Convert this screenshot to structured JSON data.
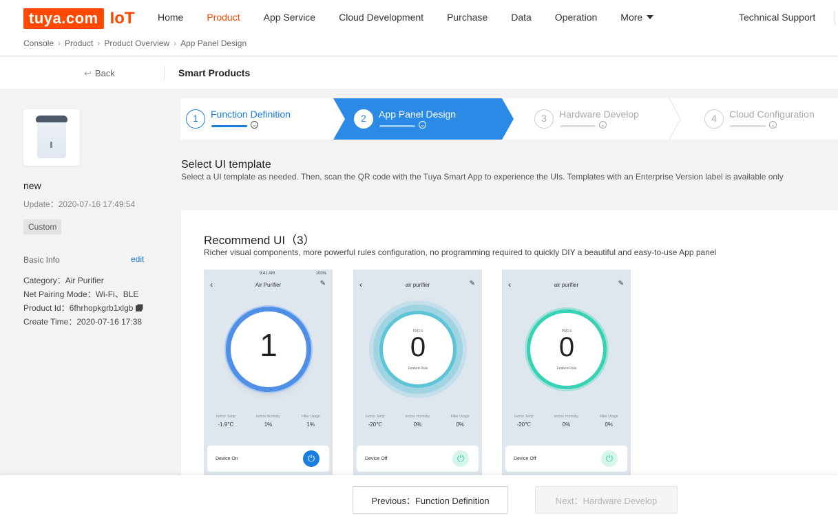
{
  "brand": {
    "logo_text": "tuya.com",
    "logo_suffix": "IoT",
    "accent": "#ff4800",
    "primary": "#1a7de0"
  },
  "nav": {
    "items": [
      "Home",
      "Product",
      "App Service",
      "Cloud Development",
      "Purchase",
      "Data",
      "Operation",
      "More"
    ],
    "active": "Product",
    "tech_support": "Technical Support"
  },
  "breadcrumb": [
    "Console",
    "Product",
    "Product Overview",
    "App Panel Design"
  ],
  "subheader": {
    "back": "Back",
    "title": "Smart Products"
  },
  "product": {
    "name": "new",
    "update": "Update：2020-07-16 17:49:54",
    "tag": "Custom",
    "basic_info_label": "Basic Info",
    "edit_label": "edit",
    "category": "Category：Air Purifier",
    "pairing": "Net Pairing Mode：Wi-Fi、BLE",
    "product_id": "Product Id：6fhrhopkgrb1xlgb",
    "create_time": "Create Time：2020-07-16 17:38"
  },
  "steps": [
    {
      "num": "1",
      "label": "Function Definition",
      "state": "done"
    },
    {
      "num": "2",
      "label": "App Panel Design",
      "state": "active"
    },
    {
      "num": "3",
      "label": "Hardware Develop",
      "state": "pending"
    },
    {
      "num": "4",
      "label": "Cloud Configuration",
      "state": "pending"
    }
  ],
  "template_section": {
    "title": "Select UI template",
    "desc": "Select a UI template as needed. Then, scan the QR code with the Tuya Smart App to experience the UIs. Templates with an Enterprise Version label is available only"
  },
  "recommend": {
    "title": "Recommend UI（3）",
    "desc": "Richer visual components, more powerful rules configuration, no programming required to quickly DIY a beautiful and easy-to-use App panel",
    "templates": [
      {
        "time": "9:41 AM",
        "battery": "100%",
        "title": "Air Purifier",
        "value": "1",
        "stats": [
          [
            "Indoor Temp",
            "-1.9°C"
          ],
          [
            "Indoor Humidity",
            "1%"
          ],
          [
            "Filter Usage",
            "1%"
          ]
        ],
        "device": "Device On",
        "power": "on"
      },
      {
        "title": "air purifier",
        "label_top": "PM2.5",
        "value": "0",
        "label_bottom": "Feature Rule",
        "stats": [
          [
            "Indoor Temp",
            "-20℃"
          ],
          [
            "Indoor Humidity",
            "0%"
          ],
          [
            "Filter Usage",
            "0%"
          ]
        ],
        "device": "Device Off",
        "power": "off"
      },
      {
        "title": "air purifier",
        "label_top": "PM2.5",
        "value": "0",
        "label_bottom": "Feature Rule",
        "stats": [
          [
            "Indoor Temp",
            "-20℃"
          ],
          [
            "Indoor Humidity",
            "0%"
          ],
          [
            "Filter Usage",
            "0%"
          ]
        ],
        "device": "Device Off",
        "power": "off"
      }
    ]
  },
  "footer": {
    "prev": "Previous：Function Definition",
    "next": "Next：Hardware Develop"
  }
}
